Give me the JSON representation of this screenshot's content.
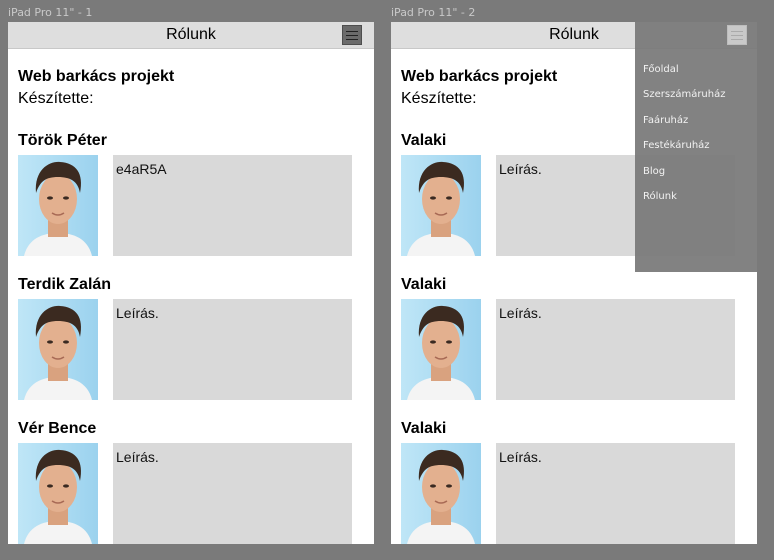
{
  "frames": [
    {
      "label": "iPad Pro 11\" - 1",
      "header_title": "Rólunk",
      "project_title": "Web barkács projekt",
      "author_label": "Készítette:",
      "members": [
        {
          "name": "Török Péter",
          "description": "e4aR5A"
        },
        {
          "name": "Terdik Zalán",
          "description": "Leírás."
        },
        {
          "name": "Vér Bence",
          "description": "Leírás."
        }
      ]
    },
    {
      "label": "iPad Pro 11\" - 2",
      "header_title": "Rólunk",
      "project_title": "Web barkács projekt",
      "author_label": "Készítette:",
      "members": [
        {
          "name": "Valaki",
          "description": "Leírás."
        },
        {
          "name": "Valaki",
          "description": "Leírás."
        },
        {
          "name": "Valaki",
          "description": "Leírás."
        }
      ],
      "menu": [
        "Főoldal",
        "Szerszámáruház",
        "Faáruház",
        "Festékáruház",
        "Blog",
        "Rólunk"
      ]
    }
  ]
}
